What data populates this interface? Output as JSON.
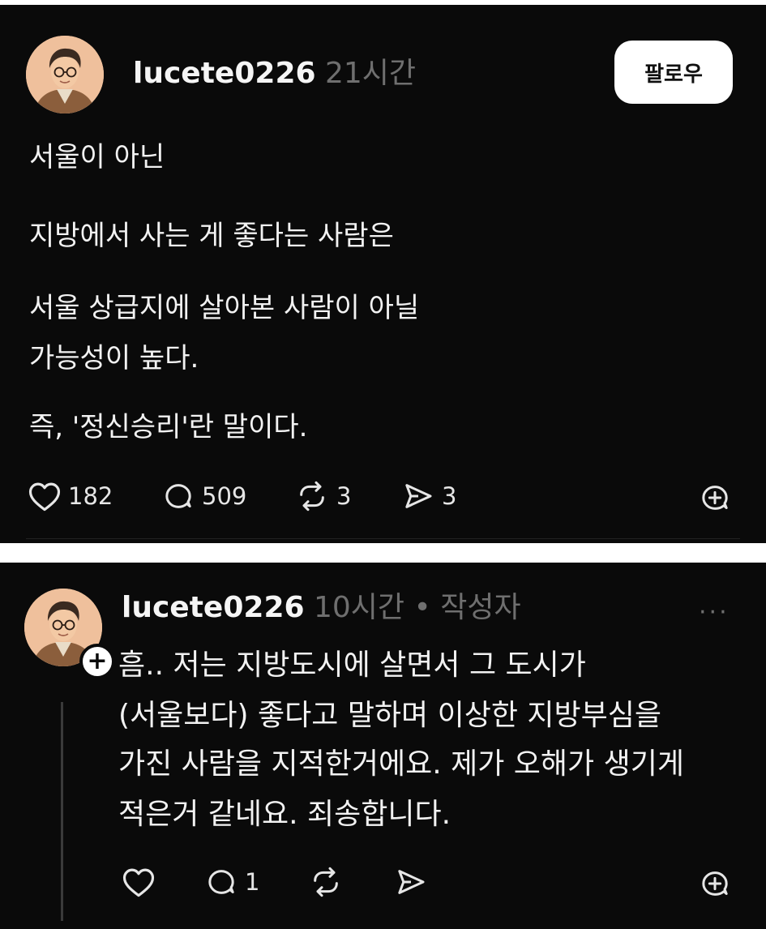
{
  "post": {
    "username": "lucete0226",
    "time": "21시간",
    "follow_label": "팔로우",
    "lines": [
      "서울이 아닌",
      "지방에서 사는 게 좋다는 사람은",
      "서울 상급지에 살아본 사람이 아닐",
      "가능성이 높다.",
      "즉, '정신승리'란 말이다."
    ],
    "likes": "182",
    "comments": "509",
    "reposts": "3",
    "shares": "3",
    "icons": [
      "heart-icon",
      "comment-icon",
      "repost-icon",
      "share-icon",
      "add-icon"
    ]
  },
  "reply": {
    "username": "lucete0226",
    "time": "10시간",
    "separator": "•",
    "author_badge": "작성자",
    "more": "···",
    "follow_plus": "+",
    "lines": [
      "흠.. 저는 지방도시에 살면서 그 도시가",
      "(서울보다) 좋다고 말하며 이상한 지방부심을",
      "가진 사람을 지적한거에요. 제가 오해가 생기게",
      "적은거 같네요. 죄송합니다."
    ],
    "comments": "1",
    "icons": [
      "heart-icon",
      "comment-icon",
      "repost-icon",
      "share-icon",
      "add-icon"
    ]
  },
  "colors": {
    "background": "#0a0a0a",
    "text": "#f2f2f2",
    "muted": "#6f6f6f",
    "button_bg": "#ffffff"
  }
}
